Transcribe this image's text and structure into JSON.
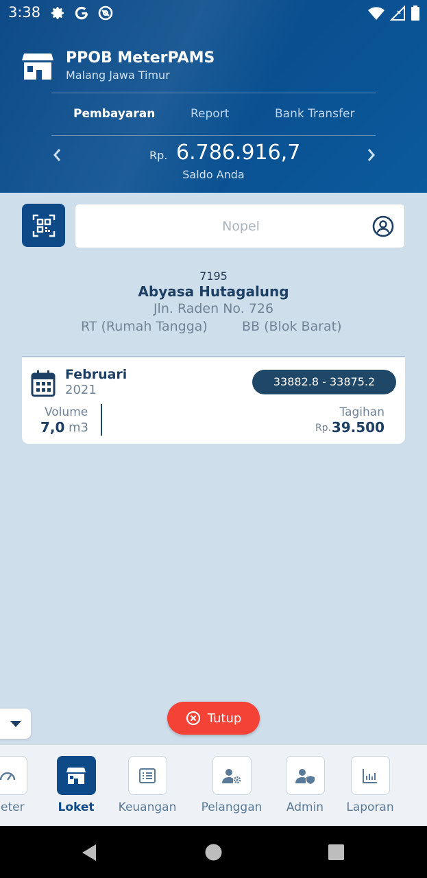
{
  "status_bar": {
    "time": "3:38"
  },
  "header": {
    "title": "PPOB MeterPAMS",
    "subtitle": "Malang Jawa Timur",
    "tabs": [
      {
        "label": "Pembayaran",
        "active": true
      },
      {
        "label": "Report",
        "active": false
      },
      {
        "label": "Bank Transfer",
        "active": false
      }
    ],
    "saldo": {
      "currency": "Rp.",
      "amount": "6.786.916,7",
      "label": "Saldo Anda"
    }
  },
  "search": {
    "placeholder": "Nopel",
    "value": ""
  },
  "customer": {
    "id": "7195",
    "name": "Abyasa Hutagalung",
    "address": "Jln. Raden No. 726",
    "type_left": "RT (Rumah Tangga)",
    "type_right": "BB (Blok Barat)"
  },
  "bill": {
    "month": "Februari",
    "year": "2021",
    "meter_range": "33882.8 - 33875.2",
    "volume_label": "Volume",
    "volume_value": "7,0",
    "volume_unit": "m3",
    "tagihan_label": "Tagihan",
    "tagihan_currency": "Rp.",
    "tagihan_value": "39.500"
  },
  "actions": {
    "close_label": "Tutup"
  },
  "bottom_nav": [
    {
      "label": "Meter",
      "icon": "gauge-icon",
      "active": false
    },
    {
      "label": "Loket",
      "icon": "store-icon",
      "active": true
    },
    {
      "label": "Keuangan",
      "icon": "list-icon",
      "active": false
    },
    {
      "label": "Pelanggan",
      "icon": "user-gear-icon",
      "active": false
    },
    {
      "label": "Admin",
      "icon": "user-shield-icon",
      "active": false
    },
    {
      "label": "Laporan",
      "icon": "bar-chart-icon",
      "active": false
    }
  ],
  "colors": {
    "primary": "#0d4a87",
    "background": "#cfdeeb",
    "pill": "#1f4768",
    "close_button": "#f44336"
  }
}
